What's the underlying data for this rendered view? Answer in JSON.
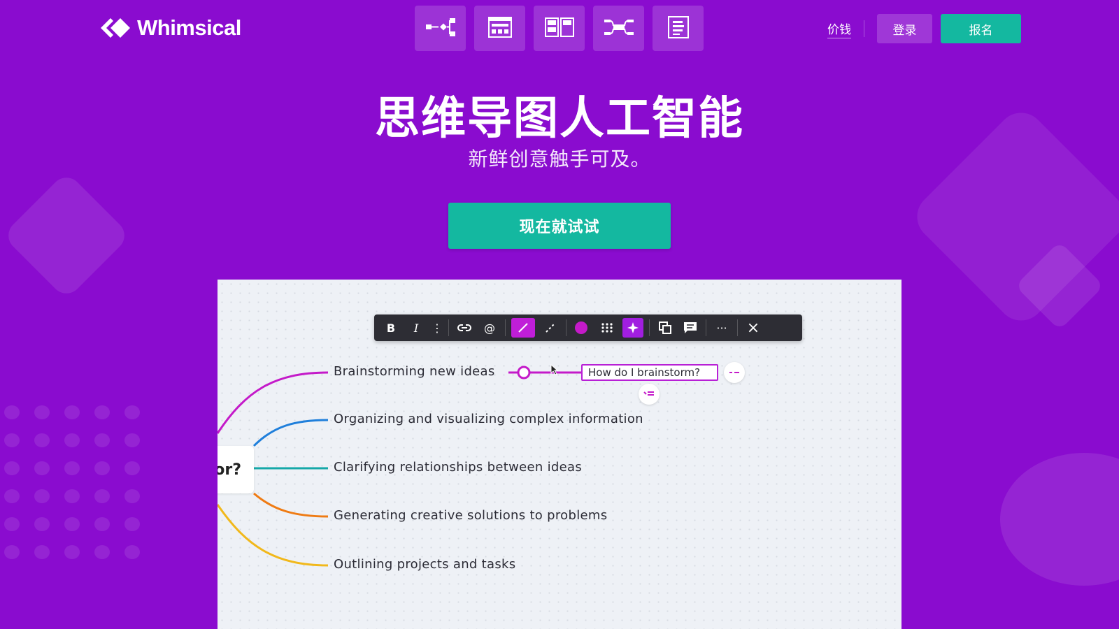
{
  "brand": {
    "name": "Whimsical"
  },
  "header": {
    "product_tiles": [
      {
        "icon": "flowchart-icon"
      },
      {
        "icon": "wireframe-icon"
      },
      {
        "icon": "board-icon"
      },
      {
        "icon": "mindmap-icon"
      },
      {
        "icon": "docs-icon"
      }
    ],
    "pricing_label": "价钱",
    "login_label": "登录",
    "signup_label": "报名"
  },
  "hero": {
    "title": "思维导图人工智能",
    "subtitle": "新鲜创意触手可及。",
    "cta_label": "现在就试试"
  },
  "canvas": {
    "toolbar": [
      "B",
      "I",
      "⋮",
      "link-icon",
      "@",
      "line-style-icon",
      "line-dashed-icon",
      "color-icon",
      "grid-icon",
      "ai-sparkle-icon",
      "duplicate-icon",
      "comment-icon",
      "···",
      "×"
    ],
    "root_label": "or?",
    "branches": [
      {
        "label": "Brainstorming new ideas",
        "color": "#c41ac9"
      },
      {
        "label": "Organizing and visualizing complex information",
        "color": "#1f7fdb"
      },
      {
        "label": "Clarifying relationships between ideas",
        "color": "#15a8a8"
      },
      {
        "label": "Generating creative solutions to problems",
        "color": "#ef7b13"
      },
      {
        "label": "Outlining projects and tasks",
        "color": "#f1b81b"
      }
    ],
    "new_node_text": "How do I brainstorm?"
  },
  "colors": {
    "background": "#8a0ccf",
    "accent_teal": "#14b8a0",
    "accent_magenta": "#c41ac9"
  }
}
